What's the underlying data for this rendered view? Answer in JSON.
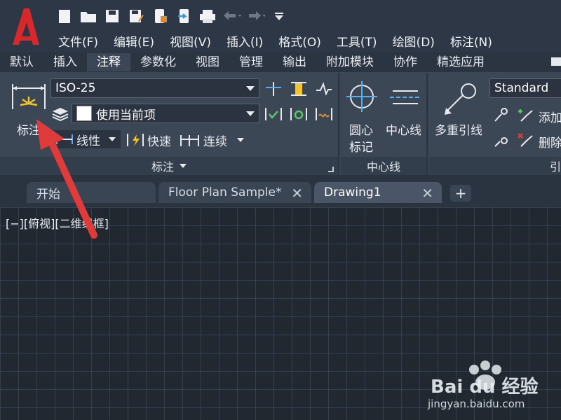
{
  "app": {
    "logo_letter": "A"
  },
  "quick_access": [
    "new-icon",
    "open-icon",
    "save-icon",
    "save-as-icon",
    "web-mobile-icon",
    "share-icon",
    "plot-icon",
    "undo-icon",
    "redo-icon",
    "customize-icon"
  ],
  "menu": [
    "文件(F)",
    "编辑(E)",
    "视图(V)",
    "插入(I)",
    "格式(O)",
    "工具(T)",
    "绘图(D)",
    "标注(N)"
  ],
  "ribbon_tabs": [
    {
      "label": "默认",
      "active": false
    },
    {
      "label": "插入",
      "active": false
    },
    {
      "label": "注释",
      "active": true
    },
    {
      "label": "参数化",
      "active": false
    },
    {
      "label": "视图",
      "active": false
    },
    {
      "label": "管理",
      "active": false
    },
    {
      "label": "输出",
      "active": false
    },
    {
      "label": "附加模块",
      "active": false
    },
    {
      "label": "协作",
      "active": false
    },
    {
      "label": "精选应用",
      "active": false
    }
  ],
  "dimension_panel": {
    "big_button_label": "标注",
    "style_value": "ISO-25",
    "layer_value": "使用当前项",
    "linear_label": "线性",
    "quick_label": "快速",
    "continue_label": "连续",
    "title": "标注"
  },
  "centerline_panel": {
    "center_mark_label_1": "圆心",
    "center_mark_label_2": "标记",
    "centerline_label": "中心线",
    "title": "中心线"
  },
  "leader_panel": {
    "multileader_label": "多重引线",
    "style_value": "Standard",
    "add_label": "添加",
    "remove_label": "删除",
    "title": "引"
  },
  "doc_tabs": [
    {
      "label": "开始",
      "active": false,
      "closable": false
    },
    {
      "label": "Floor Plan Sample*",
      "active": false,
      "closable": true
    },
    {
      "label": "Drawing1",
      "active": true,
      "closable": true
    }
  ],
  "add_tab_label": "+",
  "viewport_label": "[−][俯视][二维线框]",
  "watermark": {
    "brand": "Bai du 经验",
    "url": "jingyan.baidu.com"
  },
  "colors": {
    "accent_red": "#d8282c",
    "arrow_red": "#e03a3a",
    "canvas_bg": "#212830"
  }
}
